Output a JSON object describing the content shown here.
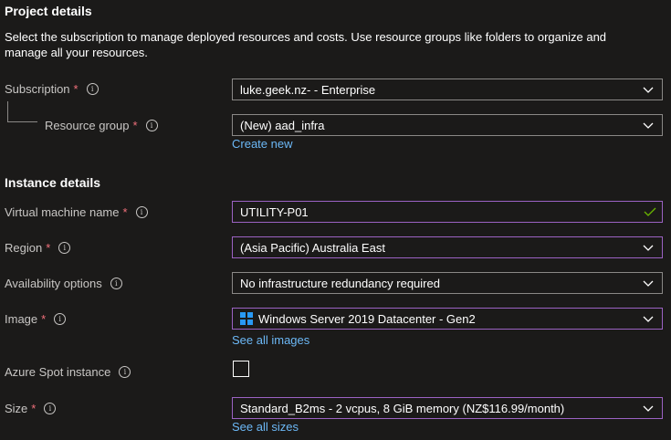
{
  "project": {
    "heading": "Project details",
    "description": "Select the subscription to manage deployed resources and costs. Use resource groups like folders to organize and manage all your resources.",
    "subscription_label": "Subscription",
    "subscription_value": "luke.geek.nz- - Enterprise",
    "resource_group_label": "Resource group",
    "resource_group_value": "(New) aad_infra",
    "create_new_link": "Create new"
  },
  "instance": {
    "heading": "Instance details",
    "vm_name_label": "Virtual machine name",
    "vm_name_value": "UTILITY-P01",
    "region_label": "Region",
    "region_value": "(Asia Pacific) Australia East",
    "availability_label": "Availability options",
    "availability_value": "No infrastructure redundancy required",
    "image_label": "Image",
    "image_value": "Windows Server 2019 Datacenter - Gen2",
    "see_all_images_link": "See all images",
    "spot_label": "Azure Spot instance",
    "spot_checked": false,
    "size_label": "Size",
    "size_value": "Standard_B2ms - 2 vcpus, 8 GiB memory (NZ$116.99/month)",
    "see_all_sizes_link": "See all sizes"
  },
  "common": {
    "required_marker": "*",
    "info_glyph": "i"
  },
  "icons": [
    "info-icon",
    "chevron-down-icon",
    "checkmark-icon",
    "windows-logo-icon"
  ],
  "colors": {
    "background": "#1b1a19",
    "label": "#c8c6c4",
    "required": "#f1707b",
    "link": "#6cb8f6",
    "focus_border": "#9b62c3",
    "valid_check": "#6bb700",
    "windows_logo": "#2899f5"
  }
}
